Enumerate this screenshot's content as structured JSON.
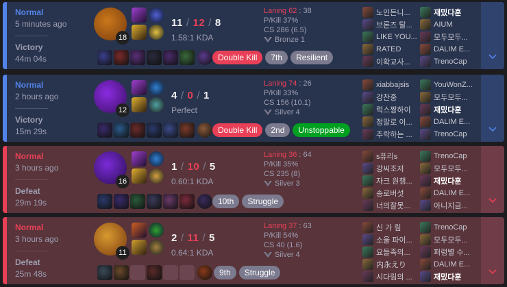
{
  "matches": [
    {
      "outcome": "win",
      "mode": "Normal",
      "ago": "5 minutes ago",
      "result": "Victory",
      "duration": "44m 04s",
      "champ_level": "18",
      "kills": "11",
      "deaths": "12",
      "assists": "8",
      "kda_text": "1.58:1 KDA",
      "laning": "Laning 62",
      "laning_opp": " : 38",
      "pkill": "P/Kill 37%",
      "cs": "CS 286 (6.5)",
      "tier": "Bronze 1",
      "items": [
        "#3a3f8a",
        "#7a2a2a",
        "#5a2f7a",
        "#2a2a3f",
        "#4a2a6a",
        "#3a6a3a",
        "#5a3a8a"
      ],
      "badges": [
        {
          "label": "Double Kill",
          "color": "red"
        },
        {
          "label": "7th",
          "color": "grey"
        },
        {
          "label": "Resilient",
          "color": "grey"
        }
      ],
      "team1": [
        "노인든니...",
        "브론즈 탈...",
        "LIKE YOU...",
        "RATED",
        "이확교사..."
      ],
      "team2": [
        "재밌다훈",
        "AIUM",
        "모두모두...",
        "DALIM E...",
        "TrenoCap"
      ],
      "me_team": 2,
      "me_index": 0
    },
    {
      "outcome": "win",
      "mode": "Normal",
      "ago": "2 hours ago",
      "result": "Victory",
      "duration": "15m 29s",
      "champ_level": "12",
      "kills": "4",
      "deaths": "0",
      "assists": "1",
      "kda_text": "Perfect",
      "laning": "Laning 74",
      "laning_opp": " : 26",
      "pkill": "P/Kill 33%",
      "cs": "CS 156 (10.1)",
      "tier": "Silver 4",
      "items": [
        "#3a2a6a",
        "#2a5a8a",
        "#6a2a2a",
        "#2a3a6a",
        "#3a4a8a",
        "#7a3a2a",
        "#8a5a3a"
      ],
      "badges": [
        {
          "label": "Double Kill",
          "color": "red"
        },
        {
          "label": "2nd",
          "color": "grey"
        },
        {
          "label": "Unstoppable",
          "color": "green"
        }
      ],
      "team1": [
        "xiabbajsis",
        "강찬중",
        "럭스짱하이",
        "정말로 이...",
        "추락하는 ..."
      ],
      "team2": [
        "YouWonZ...",
        "모두모두...",
        "재밌다훈",
        "DALIM E...",
        "TrenoCap"
      ],
      "me_team": 2,
      "me_index": 2
    },
    {
      "outcome": "loss",
      "mode": "Normal",
      "ago": "3 hours ago",
      "result": "Defeat",
      "duration": "29m 19s",
      "champ_level": "16",
      "kills": "1",
      "deaths": "10",
      "assists": "5",
      "kda_text": "0.60:1 KDA",
      "laning": "Laning 36",
      "laning_opp": " : 64",
      "pkill": "P/Kill 35%",
      "cs": "CS 235 (8)",
      "tier": "Silver 3",
      "items": [
        "#2a3a6a",
        "#3a2a6a",
        "#2a5a3a",
        "#3a3a5a",
        "#6a3a6a",
        "#7a2a3a",
        "#3a2a5a"
      ],
      "badges": [
        {
          "label": "10th",
          "color": "grey"
        },
        {
          "label": "Struggle",
          "color": "grey"
        }
      ],
      "team1": [
        "s퓨리s",
        "강씨조저",
        "자크 원챔...",
        "송로버섯",
        "너의잘못..."
      ],
      "team2": [
        "TrenoCap",
        "모두모두...",
        "재밌다훈",
        "DALIM E...",
        "아니지금..."
      ],
      "me_team": 2,
      "me_index": 2
    },
    {
      "outcome": "loss",
      "mode": "Normal",
      "ago": "3 hours ago",
      "result": "Defeat",
      "duration": "25m 48s",
      "champ_level": "11",
      "kills": "2",
      "deaths": "11",
      "assists": "5",
      "kda_text": "0.64:1 KDA",
      "laning": "Laning 37",
      "laning_opp": " : 63",
      "pkill": "P/Kill 54%",
      "cs": "CS 40 (1.6)",
      "tier": "Silver 4",
      "items": [
        "#3a4a5a",
        "#6a4a2a",
        "",
        "#5a2a2a",
        "",
        "",
        "#8a3a1a"
      ],
      "badges": [
        {
          "label": "9th",
          "color": "grey"
        },
        {
          "label": "Struggle",
          "color": "grey"
        }
      ],
      "team1": [
        "신 가 림",
        "소울 파이...",
        "요들족의...",
        "内永えり",
        "시다림의 ..."
      ],
      "team2": [
        "TrenoCap",
        "모두모두...",
        "퍼렁별 수...",
        "DALIM E...",
        "재밌다훈"
      ],
      "me_team": 2,
      "me_index": 4
    }
  ],
  "colors": {
    "win_accent": "#5383e8",
    "loss_accent": "#e84057"
  }
}
